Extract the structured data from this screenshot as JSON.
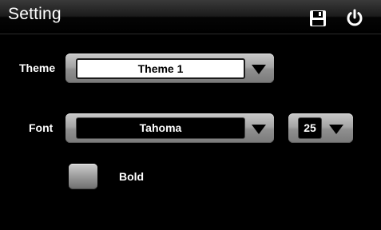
{
  "header": {
    "title": "Setting",
    "save_icon": "save-icon",
    "power_icon": "power-icon"
  },
  "theme": {
    "label": "Theme",
    "selected": "Theme 1"
  },
  "font": {
    "label": "Font",
    "selected": "Tahoma",
    "size": "25"
  },
  "bold": {
    "label": "Bold",
    "checked": false
  },
  "colors": {
    "background": "#000000",
    "control_gray": "#a6a6a6",
    "text": "#ffffff"
  }
}
